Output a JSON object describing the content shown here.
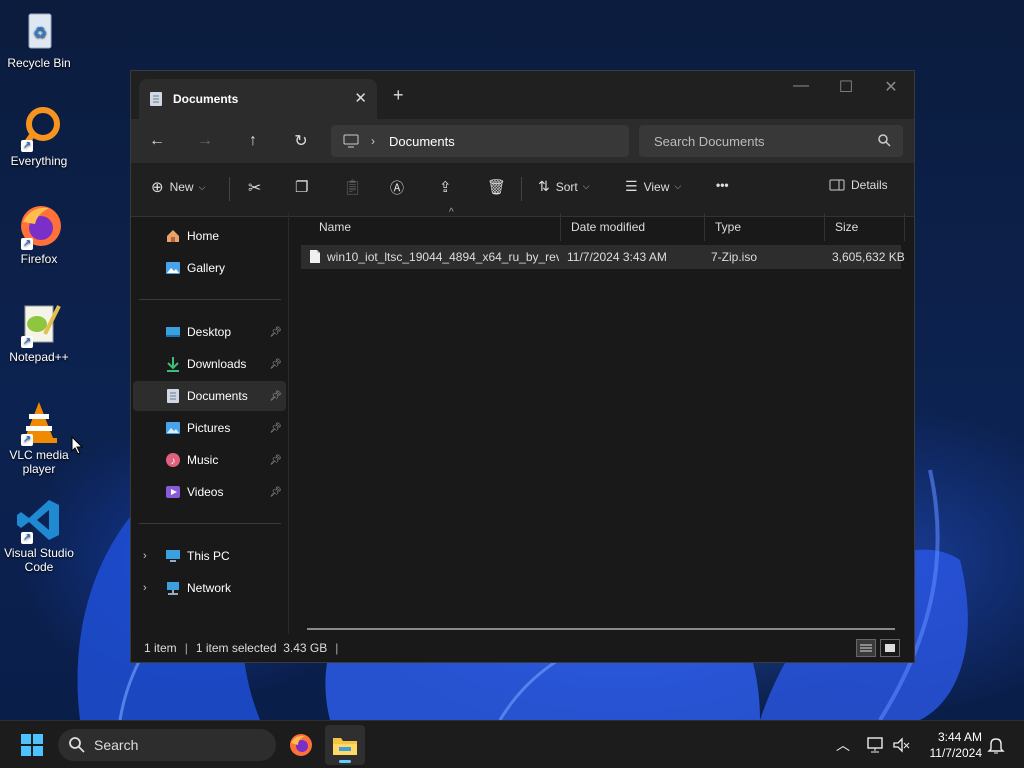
{
  "desktop": {
    "icons": [
      {
        "label": "Recycle Bin"
      },
      {
        "label": "Everything"
      },
      {
        "label": "Firefox"
      },
      {
        "label": "Notepad++"
      },
      {
        "label": "VLC media player"
      },
      {
        "label": "Visual Studio Code"
      }
    ]
  },
  "window": {
    "tab_title": "Documents",
    "new_tab": "+",
    "address": {
      "location": "Documents"
    },
    "search_placeholder": "Search Documents",
    "toolbar": {
      "new_label": "New",
      "sort_label": "Sort",
      "view_label": "View",
      "more_label": "•••",
      "details_label": "Details"
    },
    "sidebar": {
      "group1": [
        {
          "label": "Home"
        },
        {
          "label": "Gallery"
        }
      ],
      "quick_access": [
        {
          "label": "Desktop"
        },
        {
          "label": "Downloads"
        },
        {
          "label": "Documents"
        },
        {
          "label": "Pictures"
        },
        {
          "label": "Music"
        },
        {
          "label": "Videos"
        }
      ],
      "group3": [
        {
          "label": "This PC"
        },
        {
          "label": "Network"
        }
      ]
    },
    "columns": [
      "Name",
      "Date modified",
      "Type",
      "Size"
    ],
    "files": [
      {
        "name": "win10_iot_ltsc_19044_4894_x64_ru_by_revi...",
        "date": "11/7/2024 3:43 AM",
        "type": "7-Zip.iso",
        "size": "3,605,632 KB"
      }
    ],
    "status": {
      "item_count": "1 item",
      "selection": "1 item selected  3.43 GB",
      "divider": "|"
    }
  },
  "taskbar": {
    "search_label": "Search",
    "time": "3:44 AM",
    "date": "11/7/2024"
  },
  "colors": {
    "accent": "#60cdff",
    "window_bg": "#191919",
    "taskbar_bg": "#1c1c1c"
  }
}
